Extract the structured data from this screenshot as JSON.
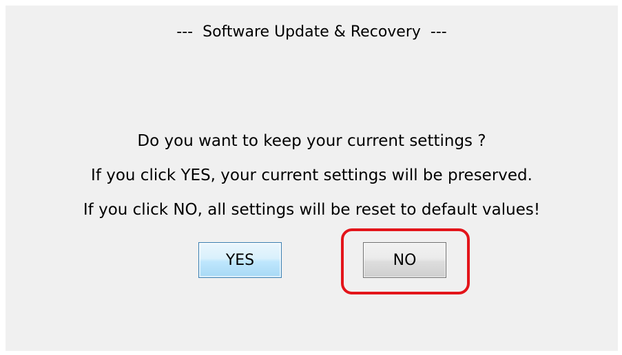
{
  "dialog": {
    "title": "---  Software Update & Recovery  ---",
    "question": "Do you want to keep your current settings ?",
    "yes_info": "If you click YES, your current settings will be preserved.",
    "no_info": "If you click NO, all settings will be reset to default values!"
  },
  "buttons": {
    "yes_label": "YES",
    "no_label": "NO"
  },
  "colors": {
    "background": "#f0f0f0",
    "highlight": "#e3141a",
    "yes_border": "#3c7fb1"
  }
}
